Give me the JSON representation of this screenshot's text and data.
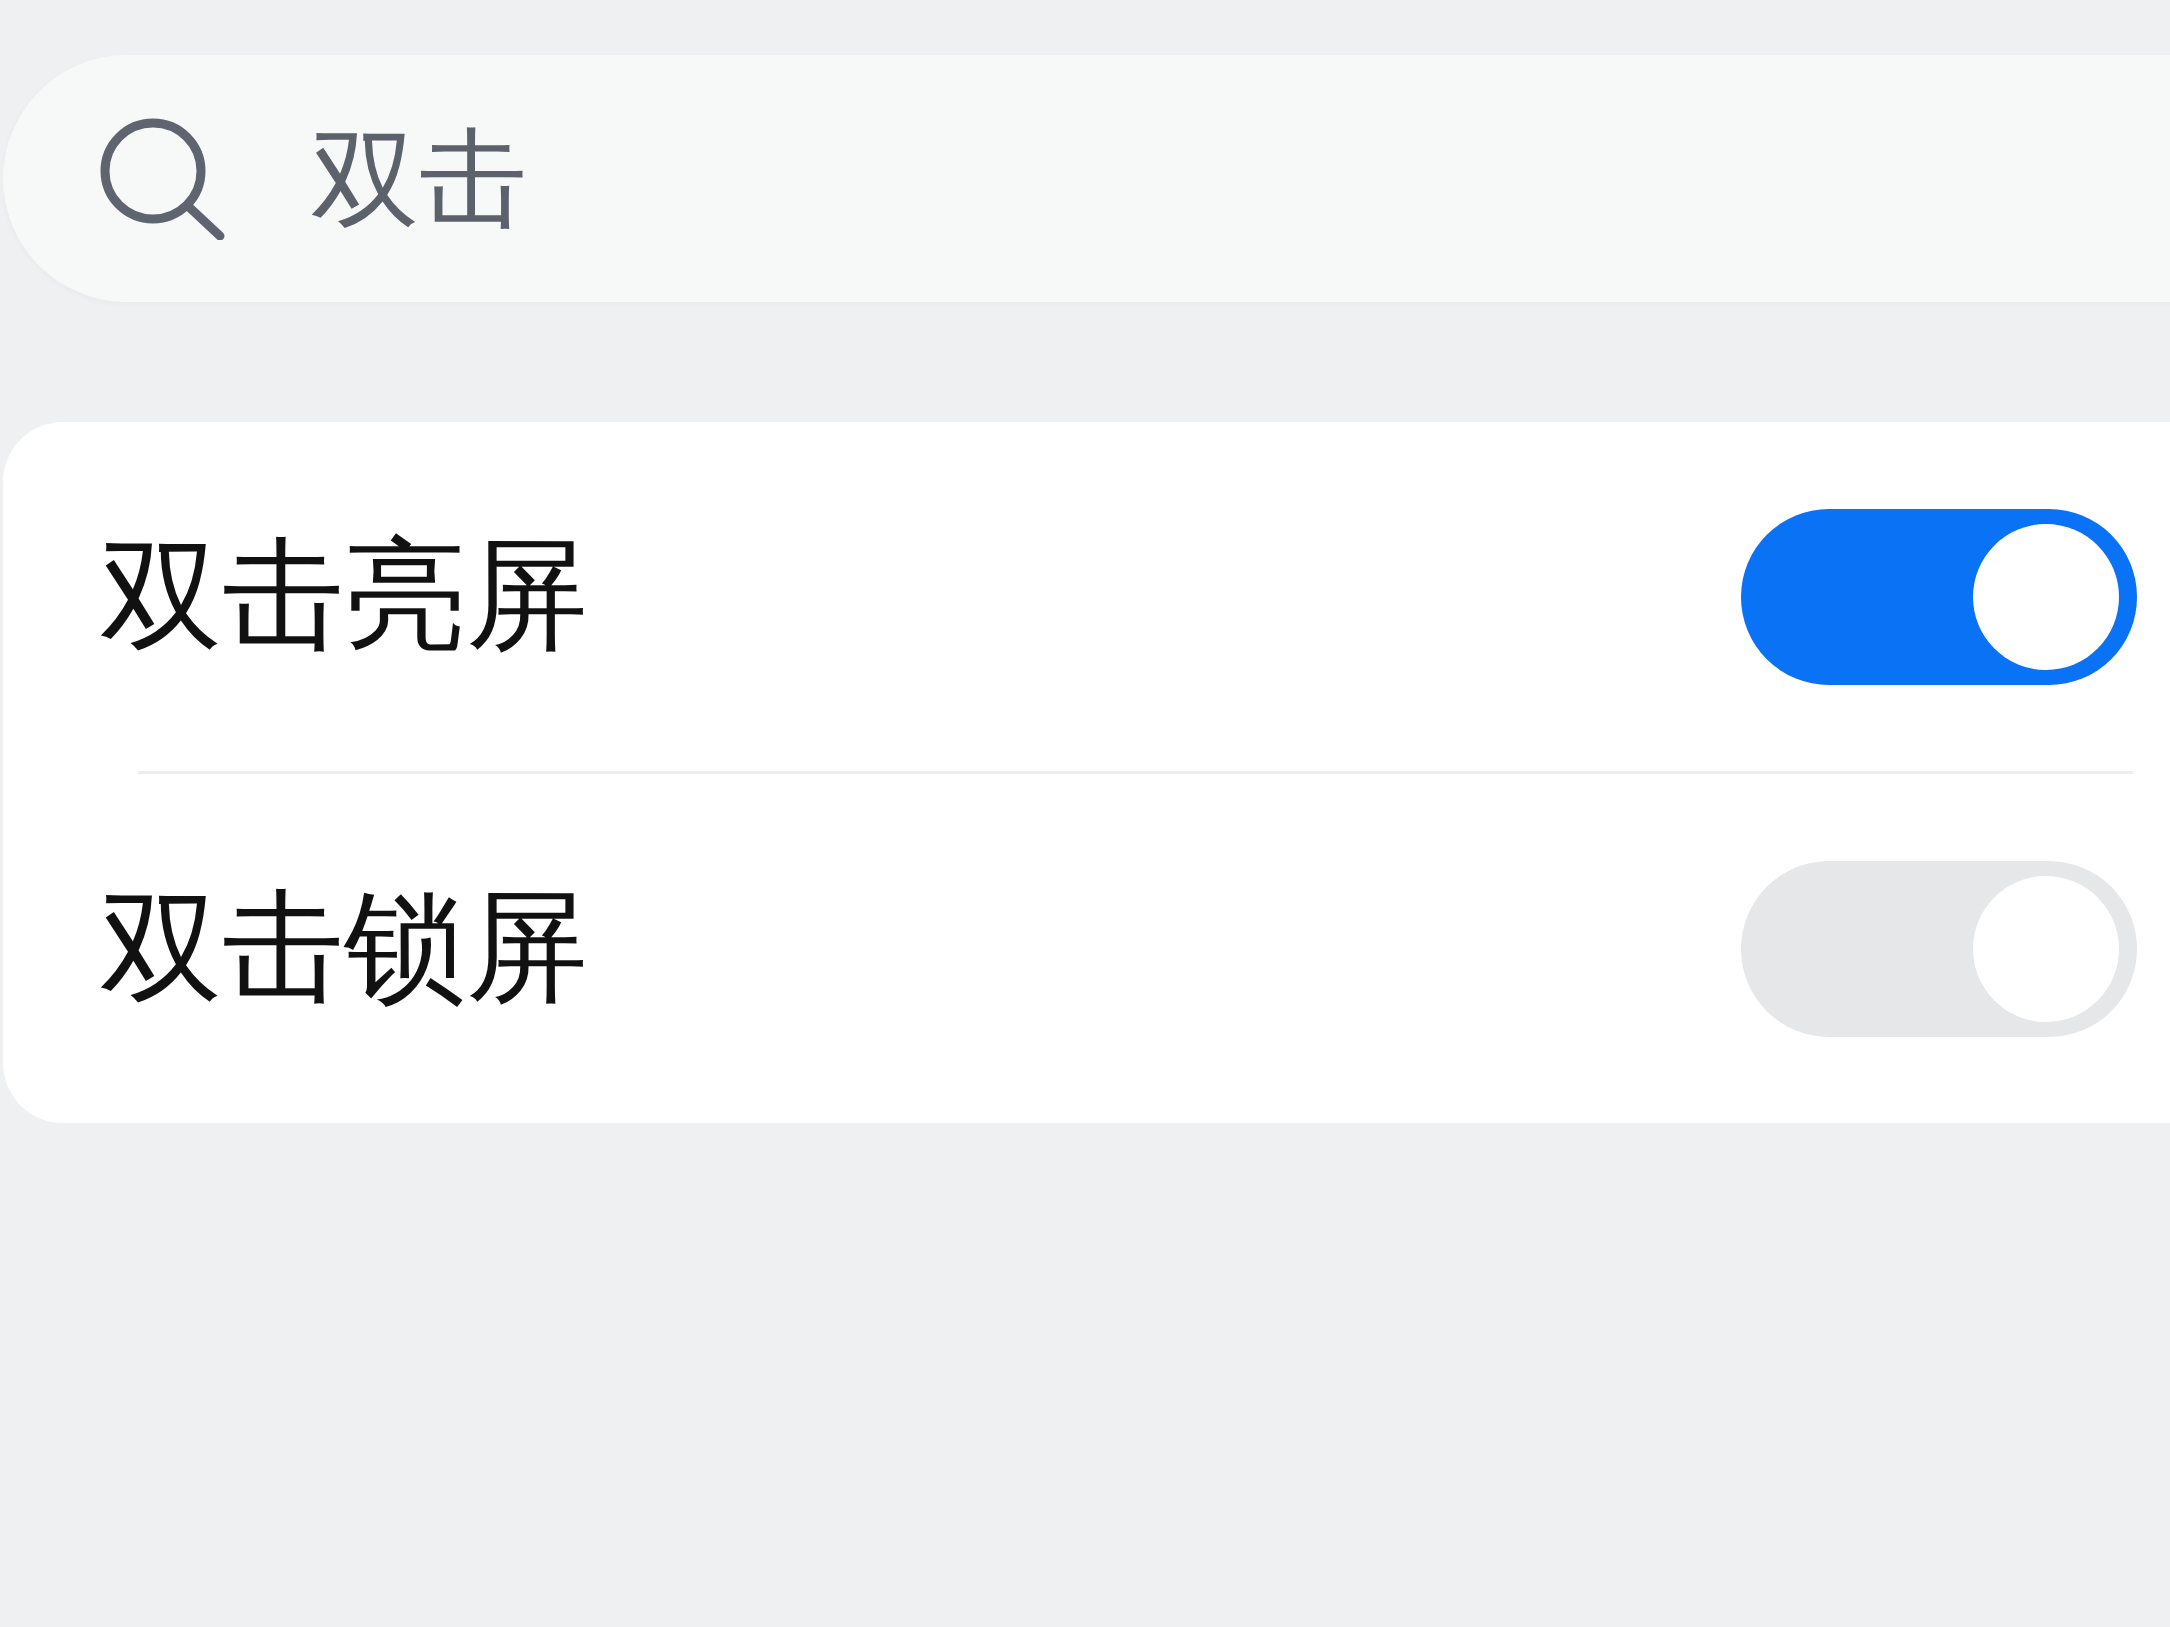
{
  "search": {
    "value": "双击"
  },
  "settings": [
    {
      "label": "双击亮屏",
      "on": true
    },
    {
      "label": "双击锁屏",
      "on": false
    }
  ]
}
